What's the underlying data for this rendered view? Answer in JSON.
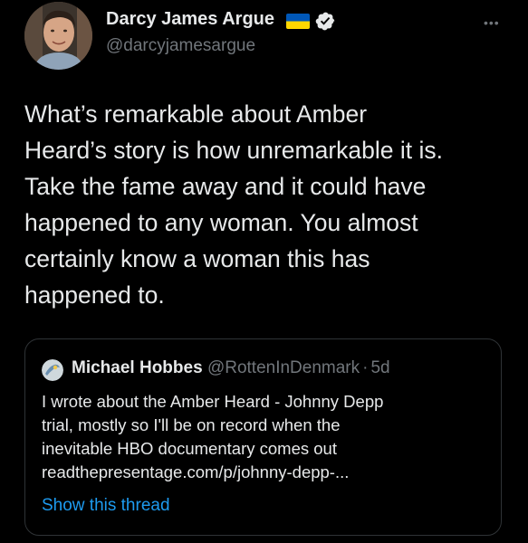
{
  "author": {
    "name": "Darcy James Argue",
    "handle": "@darcyjamesargue",
    "flag_icon": "ukraine-flag-icon",
    "verified_icon": "verified-badge-icon"
  },
  "tweet": {
    "lines": [
      "What’s remarkable about Amber",
      "Heard’s story is how unremarkable it is.",
      "Take the fame away and it could have",
      "happened to any woman. You almost",
      "certainly know a woman this has",
      "happened to."
    ]
  },
  "quote": {
    "name": "Michael Hobbes",
    "handle": "@RottenInDenmark",
    "separator": "·",
    "time": "5d",
    "lines": [
      "I wrote about the Amber Heard - Johnny Depp",
      "trial, mostly so I'll be on record when the",
      "inevitable HBO documentary comes out",
      "readthepresentage.com/p/johnny-depp-..."
    ],
    "show_thread": "Show this thread"
  },
  "colors": {
    "background": "#000000",
    "text": "#e7e9ea",
    "secondary": "#71767b",
    "link": "#1d9bf0",
    "verified": "#1d9bf0",
    "flag_blue": "#0057b7",
    "flag_yellow": "#ffd700"
  },
  "icons": {
    "more": "more-options-icon"
  }
}
